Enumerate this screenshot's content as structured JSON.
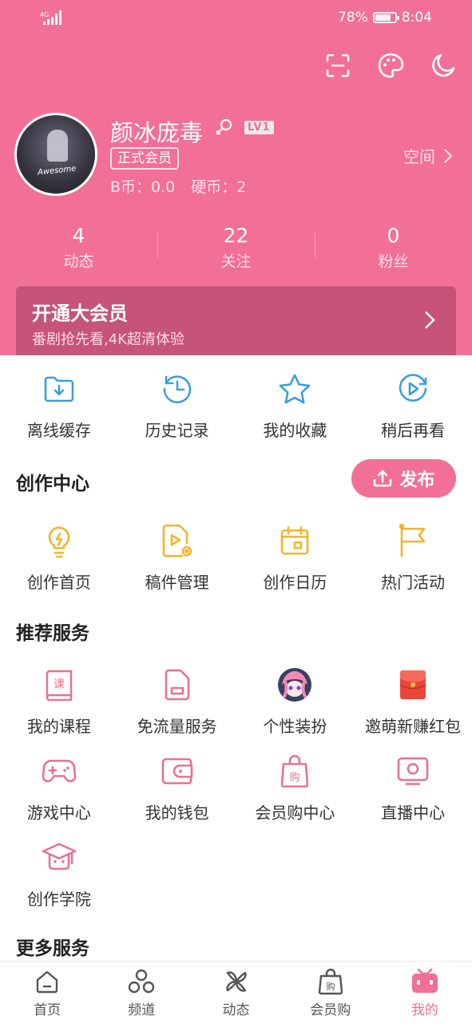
{
  "status_bar": {
    "network": "4G",
    "battery": "78%",
    "battery_level": 0.78,
    "time": "8:04"
  },
  "profile": {
    "username": "颜冰庞毒",
    "level": "LV1",
    "member_badge": "正式会员",
    "b_coin": "B币：0.0",
    "hard_coin": "硬币：2",
    "space_label": "空间",
    "avatar_text": "Awesome"
  },
  "stats": [
    {
      "value": "4",
      "label": "动态"
    },
    {
      "value": "22",
      "label": "关注"
    },
    {
      "value": "0",
      "label": "粉丝"
    }
  ],
  "vip_banner": {
    "title": "开通大会员",
    "subtitle": "番剧抢先看,4K超清体验"
  },
  "quick_actions": [
    {
      "label": "离线缓存",
      "icon": "download-folder-icon"
    },
    {
      "label": "历史记录",
      "icon": "history-clock-icon"
    },
    {
      "label": "我的收藏",
      "icon": "star-icon"
    },
    {
      "label": "稍后再看",
      "icon": "watch-later-icon"
    }
  ],
  "creator_center": {
    "title": "创作中心",
    "publish_label": "发布",
    "items": [
      {
        "label": "创作首页",
        "icon": "lightbulb-icon"
      },
      {
        "label": "稿件管理",
        "icon": "manuscript-icon"
      },
      {
        "label": "创作日历",
        "icon": "calendar-icon"
      },
      {
        "label": "热门活动",
        "icon": "flag-icon"
      }
    ]
  },
  "recommended_services": {
    "title": "推荐服务",
    "items": [
      {
        "label": "我的课程",
        "icon": "course-book-icon"
      },
      {
        "label": "免流量服务",
        "icon": "sim-card-icon"
      },
      {
        "label": "个性装扮",
        "icon": "anime-avatar-icon"
      },
      {
        "label": "邀萌新赚红包",
        "icon": "red-envelope-icon"
      },
      {
        "label": "游戏中心",
        "icon": "gamepad-icon"
      },
      {
        "label": "我的钱包",
        "icon": "wallet-icon"
      },
      {
        "label": "会员购中心",
        "icon": "shopping-bag-icon"
      },
      {
        "label": "直播中心",
        "icon": "live-tv-icon"
      },
      {
        "label": "创作学院",
        "icon": "graduation-cap-icon"
      }
    ]
  },
  "more_services": {
    "title": "更多服务"
  },
  "bottom_nav": [
    {
      "label": "首页",
      "icon": "home-icon"
    },
    {
      "label": "频道",
      "icon": "channels-icon"
    },
    {
      "label": "动态",
      "icon": "pinwheel-icon"
    },
    {
      "label": "会员购",
      "icon": "shopping-bag-icon"
    },
    {
      "label": "我的",
      "icon": "tv-mascot-icon",
      "active": true
    }
  ],
  "colors": {
    "brand_pink": "#f26f96",
    "vip_banner": "#c55478",
    "quick_blue": "#3aa0d8",
    "creator_yellow": "#f2b52a",
    "service_pink": "#e8718f"
  }
}
